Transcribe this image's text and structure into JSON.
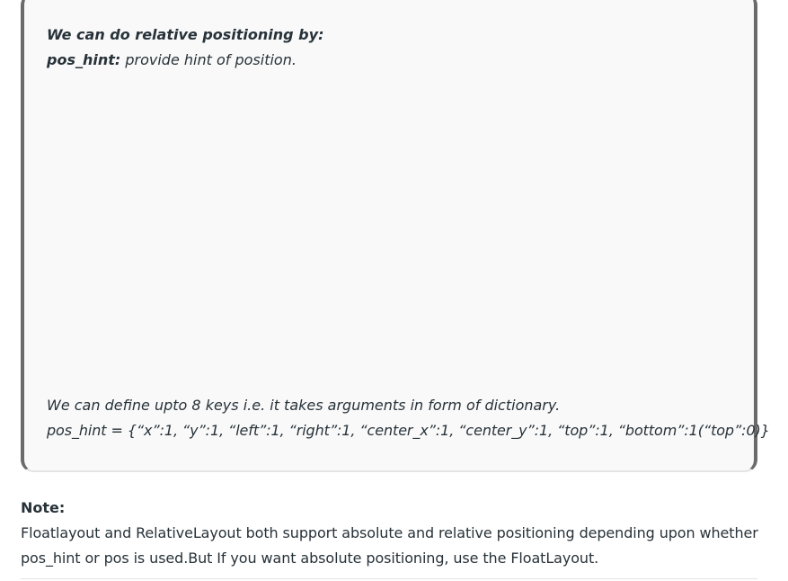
{
  "quote": {
    "heading": "We can do relative positioning by:",
    "pos_hint_label": "pos_hint:",
    "pos_hint_desc": " provide hint of position.",
    "define_keys": "We can define upto 8 keys i.e. it takes arguments in form of dictionary.",
    "pos_hint_example": "pos_hint = {“x”:1, “y”:1, “left”:1, “right”:1, “center_x”:1, “center_y”:1, “top”:1, “bottom”:1(“top”:0)}"
  },
  "note": {
    "heading": "Note:",
    "body": "Floatlayout and RelativeLayout both support absolute and relative positioning depending upon whether pos_hint or pos is used.But If you want absolute positioning, use the FloatLayout."
  }
}
